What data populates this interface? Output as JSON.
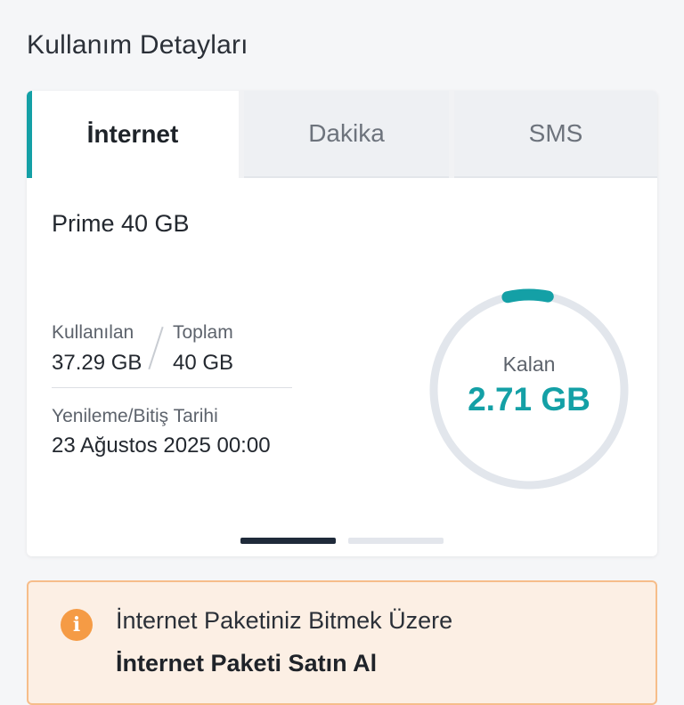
{
  "page": {
    "title": "Kullanım Detayları"
  },
  "tabs": [
    {
      "label": "İnternet",
      "active": true
    },
    {
      "label": "Dakika",
      "active": false
    },
    {
      "label": "SMS",
      "active": false
    }
  ],
  "usage": {
    "plan_name": "Prime 40 GB",
    "used_label": "Kullanılan",
    "used_value": "37.29 GB",
    "total_label": "Toplam",
    "total_value": "40 GB",
    "renewal_label": "Yenileme/Bitiş Tarihi",
    "renewal_value": "23 Ağustos 2025 00:00",
    "remaining_label": "Kalan",
    "remaining_value": "2.71 GB",
    "remaining_fraction": 0.068
  },
  "pager": {
    "count": 2,
    "active_index": 0
  },
  "alert": {
    "icon": "info-icon",
    "icon_glyph": "i",
    "message": "İnternet Paketiniz Bitmek Üzere",
    "action_label": "İnternet Paketi Satın Al"
  },
  "colors": {
    "accent": "#14a0a6",
    "ring_track": "#e2e6ec",
    "alert_bg": "#fcefe4",
    "alert_border": "#f6bd8a",
    "alert_icon": "#f59b45"
  }
}
